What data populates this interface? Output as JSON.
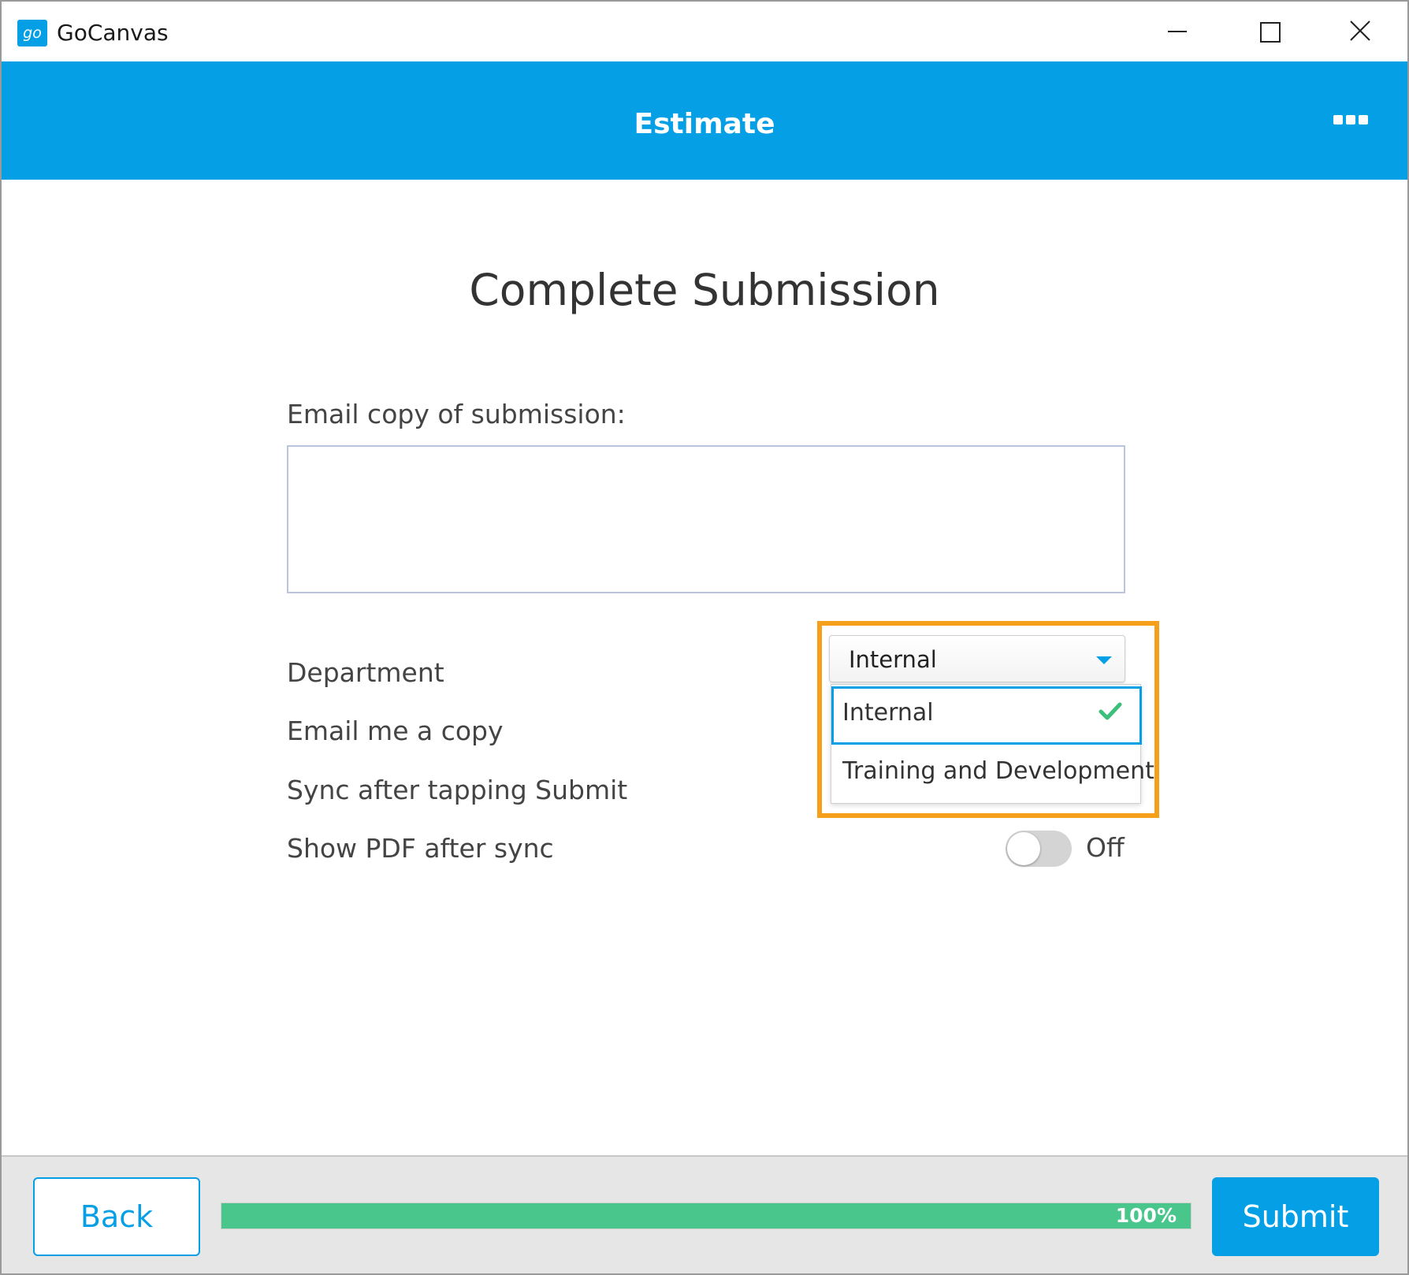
{
  "window": {
    "title": "GoCanvas",
    "logo_text": "go",
    "controls": [
      "minimize",
      "maximize",
      "close"
    ]
  },
  "header": {
    "title": "Estimate",
    "menu_icon": "more-icon"
  },
  "form": {
    "title": "Complete Submission",
    "email_label": "Email copy of submission:",
    "email_value": "",
    "department": {
      "label": "Department",
      "selected": "Internal",
      "options": [
        {
          "label": "Internal",
          "selected": true
        },
        {
          "label": "Training and Development",
          "selected": false
        }
      ]
    },
    "email_me_label": "Email me a copy",
    "sync_label": "Sync after tapping Submit",
    "show_pdf": {
      "label": "Show PDF after sync",
      "state": "Off",
      "on": false
    }
  },
  "footer": {
    "back_label": "Back",
    "submit_label": "Submit",
    "progress": {
      "value": 100,
      "text": "100%"
    }
  },
  "colors": {
    "brand_blue": "#059fe6",
    "progress_green": "#48c68b",
    "highlight_orange": "#f59f1a",
    "check_green": "#3cbf7a"
  }
}
